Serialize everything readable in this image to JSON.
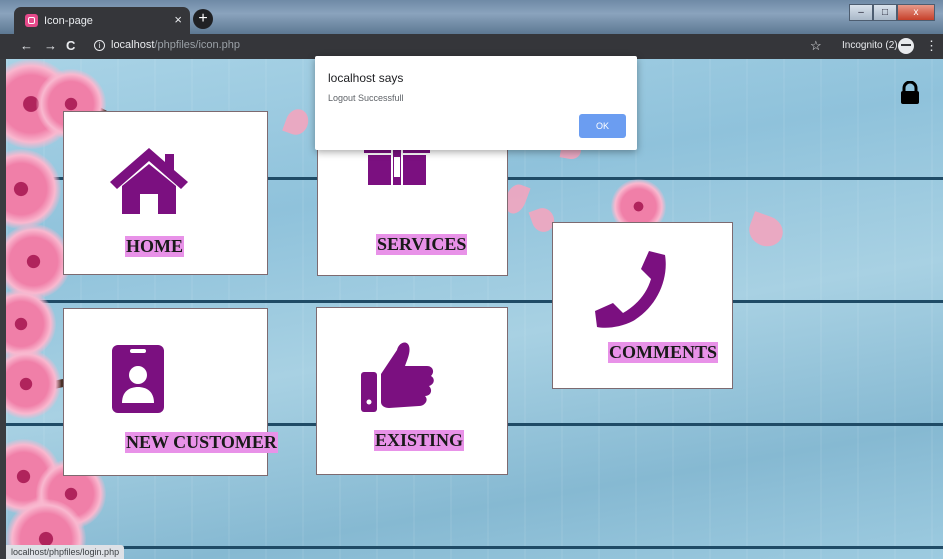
{
  "browser": {
    "tab_title": "Icon-page",
    "tab_close": "×",
    "new_tab": "+",
    "back": "←",
    "forward": "→",
    "reload": "C",
    "info": "i",
    "url_host": "localhost",
    "url_path": "/phpfiles/icon.php",
    "star": "☆",
    "incognito_label": "Incognito (2)",
    "menu": "⋮",
    "window_controls": {
      "minimize": "–",
      "maximize": "□",
      "close": "x"
    }
  },
  "cards": [
    {
      "id": "home",
      "label": "HOME",
      "icon": "home-icon"
    },
    {
      "id": "services",
      "label": "SERVICES",
      "icon": "gift-icon"
    },
    {
      "id": "comments",
      "label": "COMMENTS",
      "icon": "phone-icon"
    },
    {
      "id": "new-customer",
      "label": "NEW CUSTOMER",
      "icon": "id-badge-icon"
    },
    {
      "id": "existing",
      "label": "EXISTING",
      "icon": "thumbs-up-icon"
    }
  ],
  "header": {
    "logout_icon": "lock-icon"
  },
  "dialog": {
    "title": "localhost says",
    "message": "Logout Successfull",
    "ok_label": "OK"
  },
  "status_bar": {
    "text": "localhost/phpfiles/login.php"
  },
  "colors": {
    "icon": "#7b1080",
    "label_highlight": "#e892e8",
    "dialog_button": "#6b9df1"
  }
}
